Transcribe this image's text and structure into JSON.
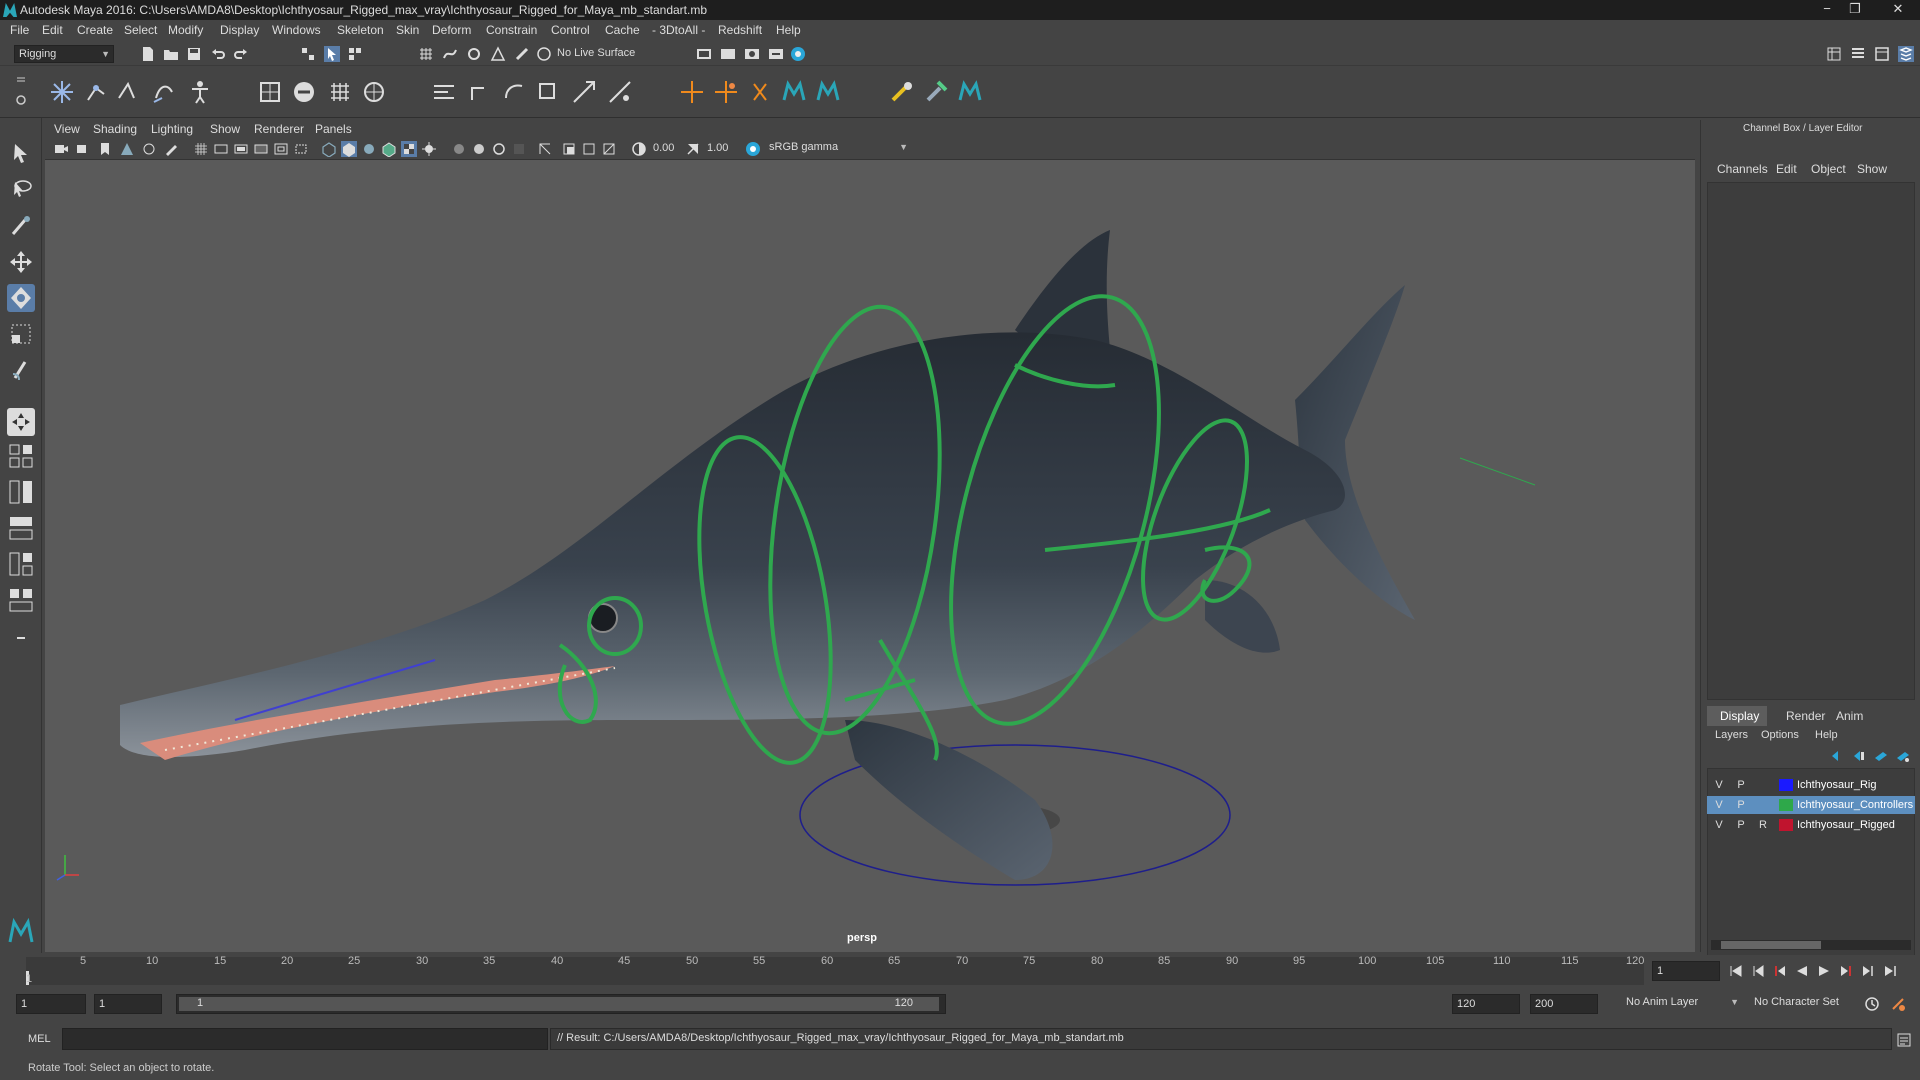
{
  "window": {
    "title": "Autodesk Maya 2016: C:\\Users\\AMDA8\\Desktop\\Ichthyosaur_Rigged_max_vray\\Ichthyosaur_Rigged_for_Maya_mb_standart.mb",
    "minimize": "−",
    "restore": "❐",
    "close": "✕"
  },
  "menubar": [
    "File",
    "Edit",
    "Create",
    "Select",
    "Modify",
    "Display",
    "Windows",
    "Skeleton",
    "Skin",
    "Deform",
    "Constrain",
    "Control",
    "Cache",
    "- 3DtoAll -",
    "Redshift",
    "Help"
  ],
  "statusline": {
    "menu_set": "Rigging",
    "live_surface": "No Live Surface"
  },
  "panel": {
    "menus": [
      "View",
      "Shading",
      "Lighting",
      "Show",
      "Renderer",
      "Panels"
    ],
    "exposure": "0.00",
    "gamma": "1.00",
    "color_space": "sRGB gamma",
    "camera_label": "persp"
  },
  "channelbox": {
    "title": "Channel Box / Layer Editor",
    "menus": [
      "Channels",
      "Edit",
      "Object",
      "Show"
    ],
    "layer_tabs": [
      "Display",
      "Render",
      "Anim"
    ],
    "layer_menus": [
      "Layers",
      "Options",
      "Help"
    ],
    "layers": [
      {
        "v": "V",
        "p": "P",
        "r": "",
        "name": "Ichthyosaur_Rig",
        "color": "#1a1aff",
        "selected": false
      },
      {
        "v": "V",
        "p": "P",
        "r": "",
        "name": "Ichthyosaur_Controllers",
        "color": "#2ea84a",
        "selected": true
      },
      {
        "v": "V",
        "p": "P",
        "r": "R",
        "name": "Ichthyosaur_Rigged",
        "color": "#c0142e",
        "selected": false
      }
    ]
  },
  "timeslider": {
    "ticks": [
      "1",
      "5",
      "10",
      "15",
      "20",
      "25",
      "30",
      "35",
      "40",
      "45",
      "50",
      "55",
      "60",
      "65",
      "70",
      "75",
      "80",
      "85",
      "90",
      "95",
      "100",
      "105",
      "110",
      "115",
      "120"
    ],
    "current_frame": "1"
  },
  "range": {
    "start": "1",
    "anim_start": "1",
    "slider_start": "1",
    "slider_end": "120",
    "end": "120",
    "anim_end": "200",
    "anim_layer": "No Anim Layer",
    "character_set": "No Character Set"
  },
  "cmdline": {
    "language": "MEL",
    "result": "// Result: C:/Users/AMDA8/Desktop/Ichthyosaur_Rigged_max_vray/Ichthyosaur_Rigged_for_Maya_mb_standart.mb"
  },
  "helpline": "Rotate Tool: Select an object to rotate."
}
